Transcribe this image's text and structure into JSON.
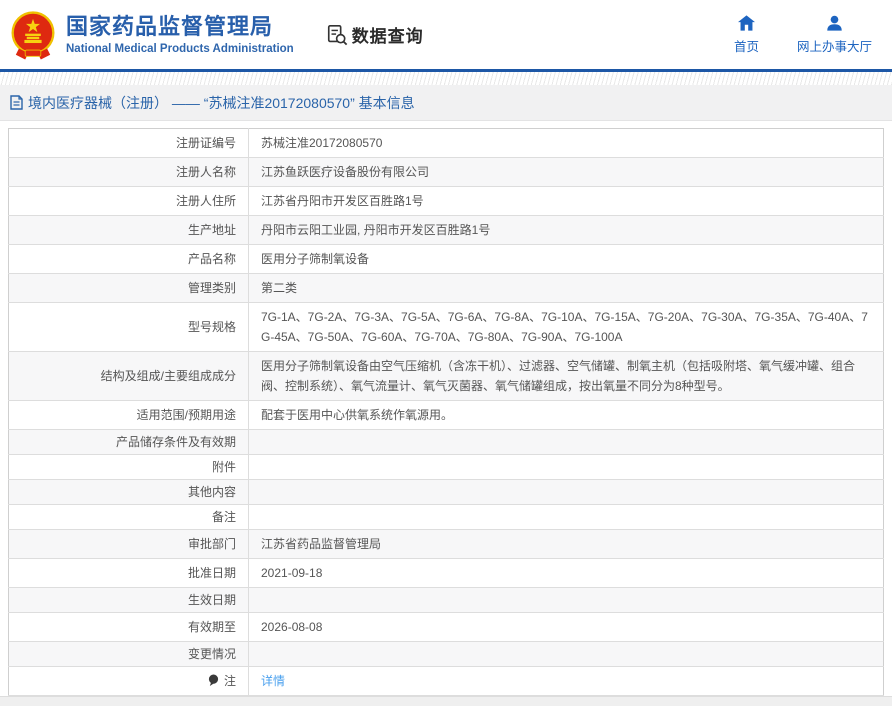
{
  "header": {
    "org_name_zh": "国家药品监督管理局",
    "org_name_en": "National Medical Products Administration",
    "query_label": "数据查询",
    "nav": [
      {
        "label": "首页",
        "icon": "home-icon"
      },
      {
        "label": "网上办事大厅",
        "icon": "person-icon"
      }
    ]
  },
  "breadcrumb": {
    "text": "境内医疗器械（注册） —— “苏械注准20172080570” 基本信息"
  },
  "table": {
    "rows": [
      {
        "label": "注册证编号",
        "value": "苏械注准20172080570"
      },
      {
        "label": "注册人名称",
        "value": "江苏鱼跃医疗设备股份有限公司"
      },
      {
        "label": "注册人住所",
        "value": "江苏省丹阳市开发区百胜路1号"
      },
      {
        "label": "生产地址",
        "value": "丹阳市云阳工业园, 丹阳市开发区百胜路1号"
      },
      {
        "label": "产品名称",
        "value": "医用分子筛制氧设备"
      },
      {
        "label": "管理类别",
        "value": "第二类"
      },
      {
        "label": "型号规格",
        "value": "7G-1A、7G-2A、7G-3A、7G-5A、7G-6A、7G-8A、7G-10A、7G-15A、7G-20A、7G-30A、7G-35A、7G-40A、7G-45A、7G-50A、7G-60A、7G-70A、7G-80A、7G-90A、7G-100A"
      },
      {
        "label": "结构及组成/主要组成成分",
        "value": "医用分子筛制氧设备由空气压缩机（含冻干机）、过滤器、空气储罐、制氧主机（包括吸附塔、氧气缓冲罐、组合阀、控制系统）、氧气流量计、氧气灭菌器、氧气储罐组成，按出氧量不同分为8种型号。"
      },
      {
        "label": "适用范围/预期用途",
        "value": "配套于医用中心供氧系统作氧源用。"
      },
      {
        "label": "产品储存条件及有效期",
        "value": ""
      },
      {
        "label": "附件",
        "value": ""
      },
      {
        "label": "其他内容",
        "value": ""
      },
      {
        "label": "备注",
        "value": ""
      },
      {
        "label": "审批部门",
        "value": "江苏省药品监督管理局"
      },
      {
        "label": "批准日期",
        "value": "2021-09-18"
      },
      {
        "label": "生效日期",
        "value": ""
      },
      {
        "label": "有效期至",
        "value": "2026-08-08"
      },
      {
        "label": "变更情况",
        "value": ""
      },
      {
        "label": "注",
        "label_icon": "note-balloon-icon",
        "value": "详情",
        "link": true
      }
    ]
  },
  "colors": {
    "brand_blue": "#285fab",
    "nav_blue": "#1d64c0",
    "breadcrumb_blue": "#2a64a9",
    "link_blue": "#4aa0ee",
    "header_border_blue": "#1d57a6",
    "emblem_red": "#de2910",
    "emblem_gold": "#f0c000",
    "text_gray": "#555555",
    "border_gray": "#dddddd",
    "zebra_bg": "#f7f7f8",
    "breadcrumb_bg": "#f1f1f2"
  }
}
